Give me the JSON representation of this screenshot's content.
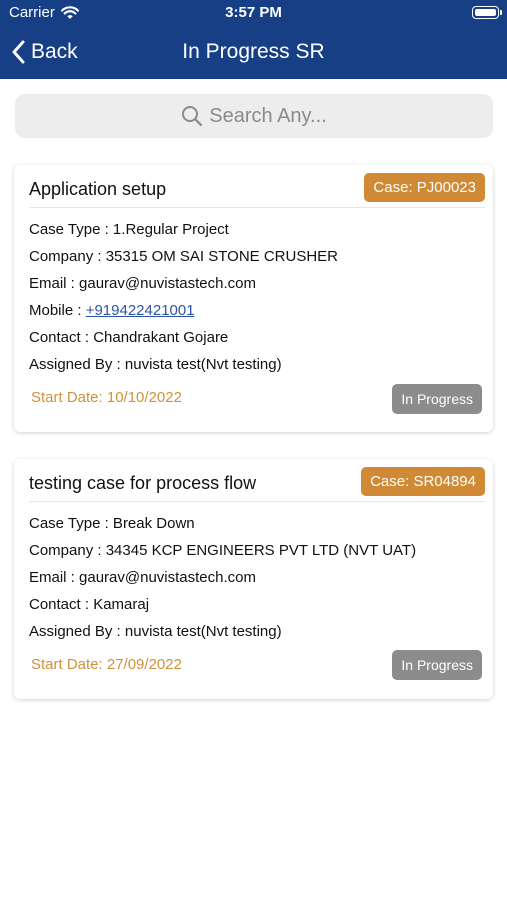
{
  "status_bar": {
    "carrier": "Carrier",
    "time": "3:57 PM",
    "icons": [
      "wifi-icon",
      "battery-icon"
    ]
  },
  "nav": {
    "back_label": "Back",
    "title": "In Progress SR",
    "back_icon": "chevron-left-icon"
  },
  "search": {
    "placeholder": "Search Any...",
    "icon": "search-icon"
  },
  "colors": {
    "nav_bg": "#163f86",
    "badge_orange": "#d08a35",
    "status_gray": "#8c8c8c",
    "start_date": "#d0923a",
    "link": "#2c55a8"
  },
  "cases": [
    {
      "title": "Application setup",
      "case_label": "Case: PJ00023",
      "case_type": "Case Type : 1.Regular Project",
      "company": "Company : 35315 OM SAI STONE CRUSHER",
      "email": "Email : gaurav@nuvistastech.com",
      "mobile_label": "Mobile : ",
      "mobile": "+919422421001",
      "contact": "Contact : Chandrakant Gojare",
      "assigned_by": "Assigned By : nuvista test(Nvt testing)",
      "start_date": "Start Date: 10/10/2022",
      "status": "In Progress"
    },
    {
      "title": "testing case for process flow",
      "case_label": "Case: SR04894",
      "case_type": "Case Type : Break Down",
      "company": "Company : 34345 KCP ENGINEERS PVT LTD (NVT UAT)",
      "email": "Email : gaurav@nuvistastech.com",
      "contact": "Contact : Kamaraj",
      "assigned_by": "Assigned By : nuvista test(Nvt testing)",
      "start_date": "Start Date: 27/09/2022",
      "status": "In Progress"
    }
  ]
}
